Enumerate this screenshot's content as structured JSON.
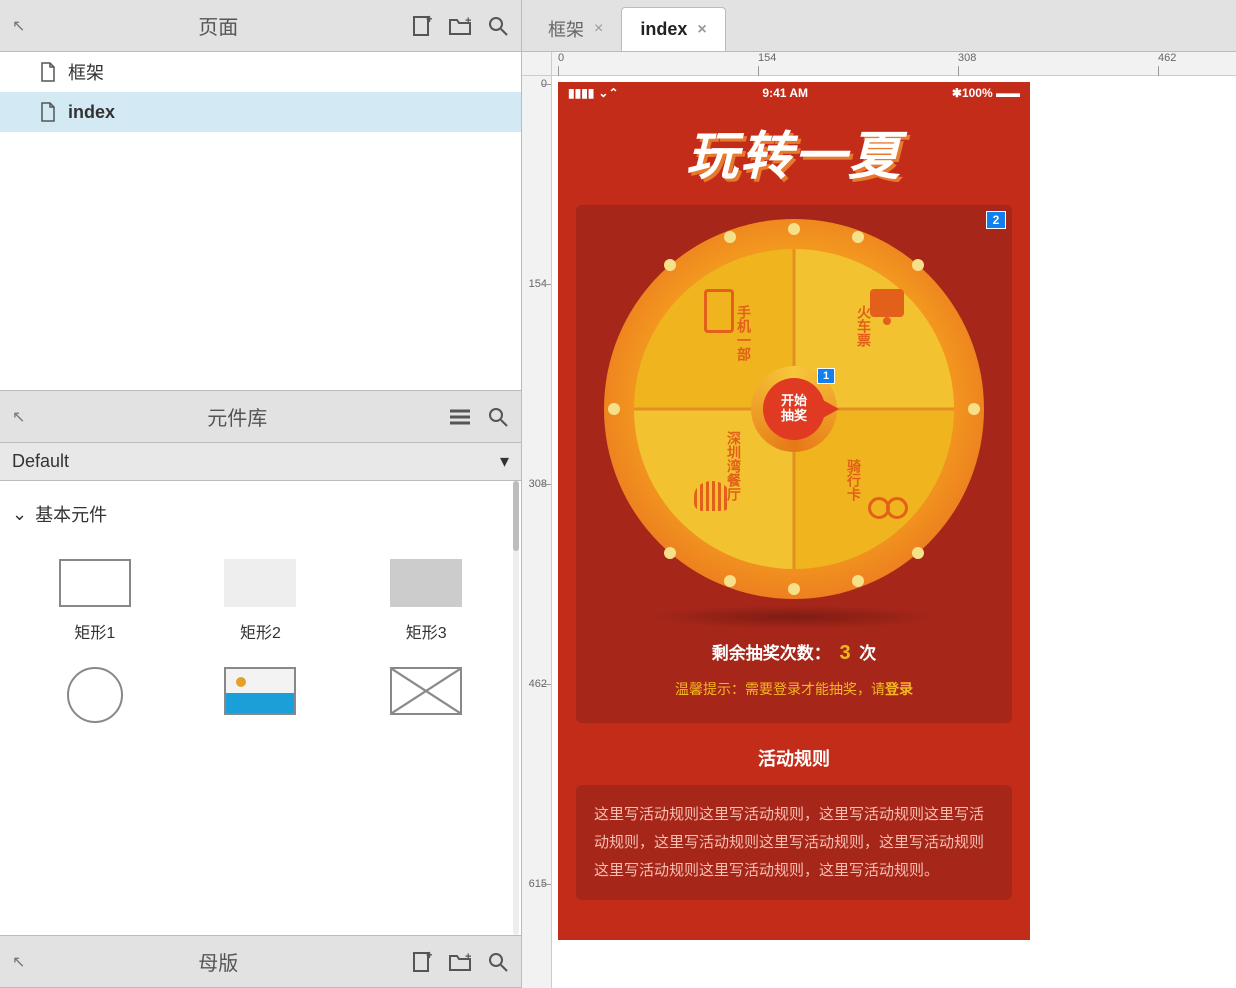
{
  "panels": {
    "pages": {
      "title": "页面",
      "items": [
        {
          "label": "框架",
          "selected": false
        },
        {
          "label": "index",
          "selected": true
        }
      ]
    },
    "library": {
      "title": "元件库",
      "selector": "Default",
      "group_title": "基本元件",
      "items": [
        {
          "label": "矩形1"
        },
        {
          "label": "矩形2"
        },
        {
          "label": "矩形3"
        },
        {
          "label": ""
        },
        {
          "label": ""
        },
        {
          "label": ""
        }
      ]
    },
    "masters": {
      "title": "母版"
    }
  },
  "tabs": [
    {
      "label": "框架",
      "active": false
    },
    {
      "label": "index",
      "active": true
    }
  ],
  "rulers": {
    "h": [
      "0",
      "154",
      "308",
      "462"
    ],
    "v": [
      "0",
      "154",
      "308",
      "462",
      "615"
    ]
  },
  "artboard": {
    "status": {
      "time": "9:41 AM",
      "battery": "100%"
    },
    "hero_title": "玩转一夏",
    "badges": {
      "note_outer": "2",
      "note_center": "1"
    },
    "wheel": {
      "center_line1": "开始",
      "center_line2": "抽奖",
      "prizes": {
        "tl": "手机一部",
        "tr": "火车票",
        "bl": "深圳湾餐厅",
        "br": "骑行卡"
      }
    },
    "remaining": {
      "prefix": "剩余抽奖次数：",
      "count": "3",
      "suffix": "次"
    },
    "tip": {
      "prefix": "温馨提示：需要登录才能抽奖，请",
      "link": "登录"
    },
    "rules_title": "活动规则",
    "rules_body": "这里写活动规则这里写活动规则，这里写活动规则这里写活动规则，这里写活动规则这里写活动规则，这里写活动规则这里写活动规则这里写活动规则，这里写活动规则。"
  }
}
